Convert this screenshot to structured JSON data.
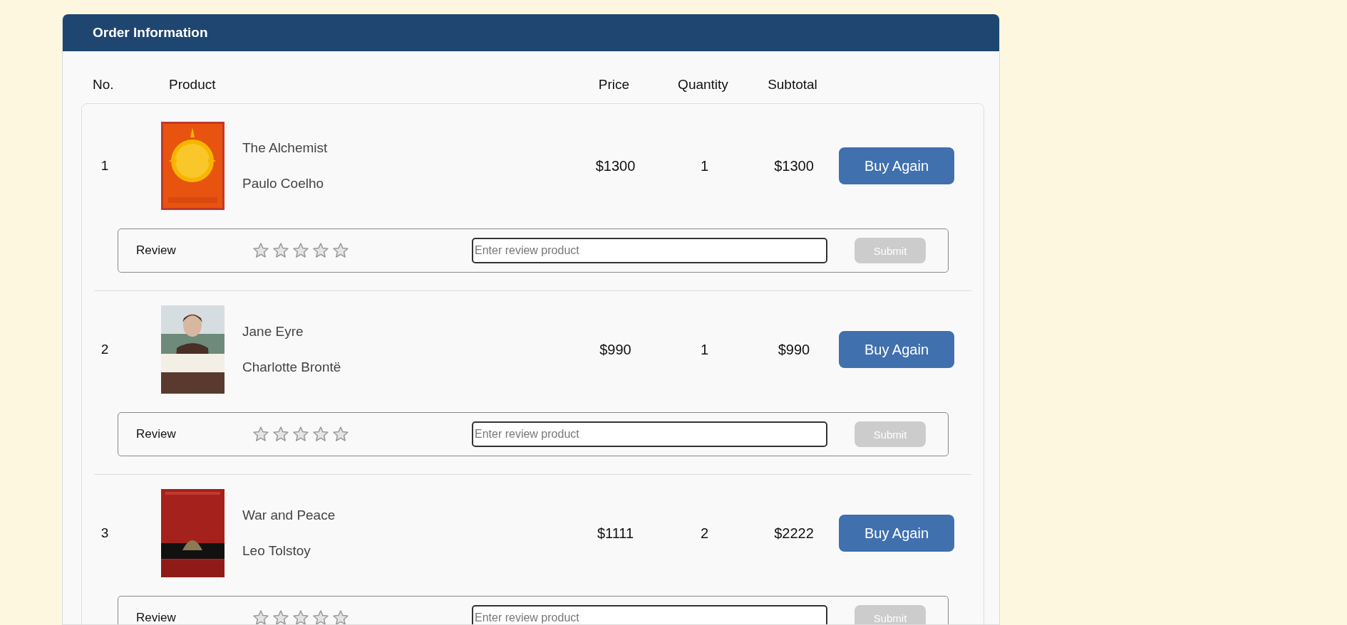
{
  "panel": {
    "title": "Order Information"
  },
  "columns": [
    "No.",
    "Product",
    "Price",
    "Quantity",
    "Subtotal"
  ],
  "orders": [
    {
      "no": "1",
      "title": "The Alchemist",
      "author": "Paulo Coelho",
      "price": "$1300",
      "quantity": "1",
      "subtotal": "$1300",
      "action": "Buy Again",
      "review": {
        "label": "Review",
        "stars": 0,
        "placeholder": "Enter review product",
        "submit": "Submit",
        "disabled": true
      }
    },
    {
      "no": "2",
      "title": "Jane Eyre",
      "author": "Charlotte Brontë",
      "price": "$990",
      "quantity": "1",
      "subtotal": "$990",
      "action": "Buy Again",
      "review": {
        "label": "Review",
        "stars": 0,
        "placeholder": "Enter review product",
        "submit": "Submit",
        "disabled": true
      }
    },
    {
      "no": "3",
      "title": "War and Peace",
      "author": "Leo Tolstoy",
      "price": "$1111",
      "quantity": "2",
      "subtotal": "$2222",
      "action": "Buy Again",
      "review": {
        "label": "Review",
        "stars": 0,
        "placeholder": "Enter review product",
        "submit": "Submit",
        "disabled": true
      }
    }
  ]
}
